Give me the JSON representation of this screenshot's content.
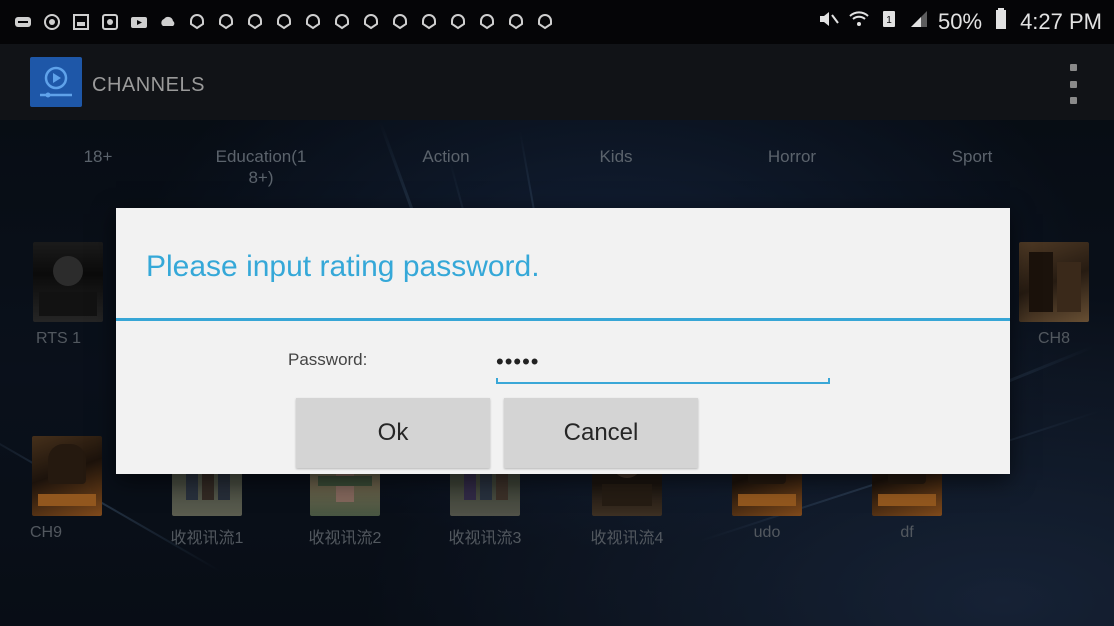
{
  "status_bar": {
    "left_icons": [
      "message-icon",
      "circle-badge-icon",
      "gallery-icon",
      "app-icon",
      "video-icon",
      "cloud-icon",
      "notification-icon",
      "notification-icon",
      "notification-icon",
      "notification-icon",
      "notification-icon",
      "notification-icon",
      "notification-icon",
      "notification-icon",
      "notification-icon",
      "notification-icon",
      "notification-icon",
      "notification-icon"
    ],
    "battery": "50%",
    "time": "4:27 PM"
  },
  "app_bar": {
    "title": "CHANNELS",
    "logo_color": "#1e57a8"
  },
  "categories": [
    {
      "label": "18+"
    },
    {
      "label": "Education(1\n8+)"
    },
    {
      "label": "Action"
    },
    {
      "label": "Kids"
    },
    {
      "label": "Horror"
    },
    {
      "label": "Sport"
    }
  ],
  "channels_row1": [
    {
      "label": "RTS 1"
    },
    {
      "label": "CH8"
    }
  ],
  "channels_row2": [
    {
      "label": "CH9"
    },
    {
      "label": "收视讯流1"
    },
    {
      "label": "收视讯流2"
    },
    {
      "label": "收视讯流3"
    },
    {
      "label": "收视讯流4"
    },
    {
      "label": "udo"
    },
    {
      "label": "df"
    }
  ],
  "dialog": {
    "title": "Please input rating password.",
    "password_label": "Password:",
    "password_value": "•••••",
    "ok_label": "Ok",
    "cancel_label": "Cancel",
    "accent_color": "#35a8d8"
  }
}
